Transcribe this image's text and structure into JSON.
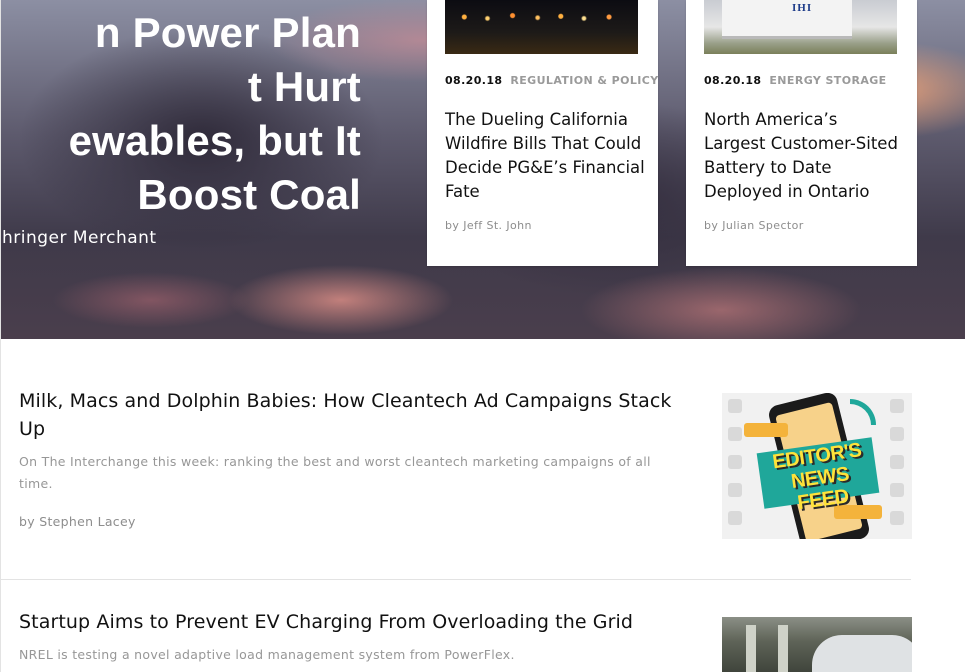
{
  "hero": {
    "title": "n Power Plan t Hurt ewables, but It Boost Coal",
    "title_lines": [
      "n Power Plan",
      "t Hurt",
      "ewables, but It",
      "Boost Coal"
    ],
    "author": "ehringer Merchant"
  },
  "cards": [
    {
      "date": "08.20.18",
      "category": "REGULATION & POLICY",
      "title": "The Dueling California Wildfire Bills That Could Decide PG&E’s Financial Fate",
      "author": "by Jeff St. John"
    },
    {
      "date": "08.20.18",
      "category": "ENERGY STORAGE",
      "title": "North America’s Largest Customer-Sited Battery to Date Deployed in Ontario",
      "author": "by Julian Spector",
      "thumb_brand": "IHI"
    }
  ],
  "articles": [
    {
      "title": "Milk, Macs and Dolphin Babies: How Cleantech Ad Campaigns Stack Up",
      "excerpt": "On The Interchange this week: ranking the best and worst cleantech marketing campaigns of all time.",
      "author": "by Stephen Lacey",
      "thumb_text": "EDITOR'S NEWS FEED"
    },
    {
      "title": "Startup Aims to Prevent EV Charging From Overloading the Grid",
      "excerpt": "NREL is testing a novel adaptive load management system from PowerFlex."
    }
  ],
  "colors": {
    "text": "#111111",
    "muted": "#979797",
    "teal": "#1fa79a",
    "yellow": "#ffe23a"
  }
}
